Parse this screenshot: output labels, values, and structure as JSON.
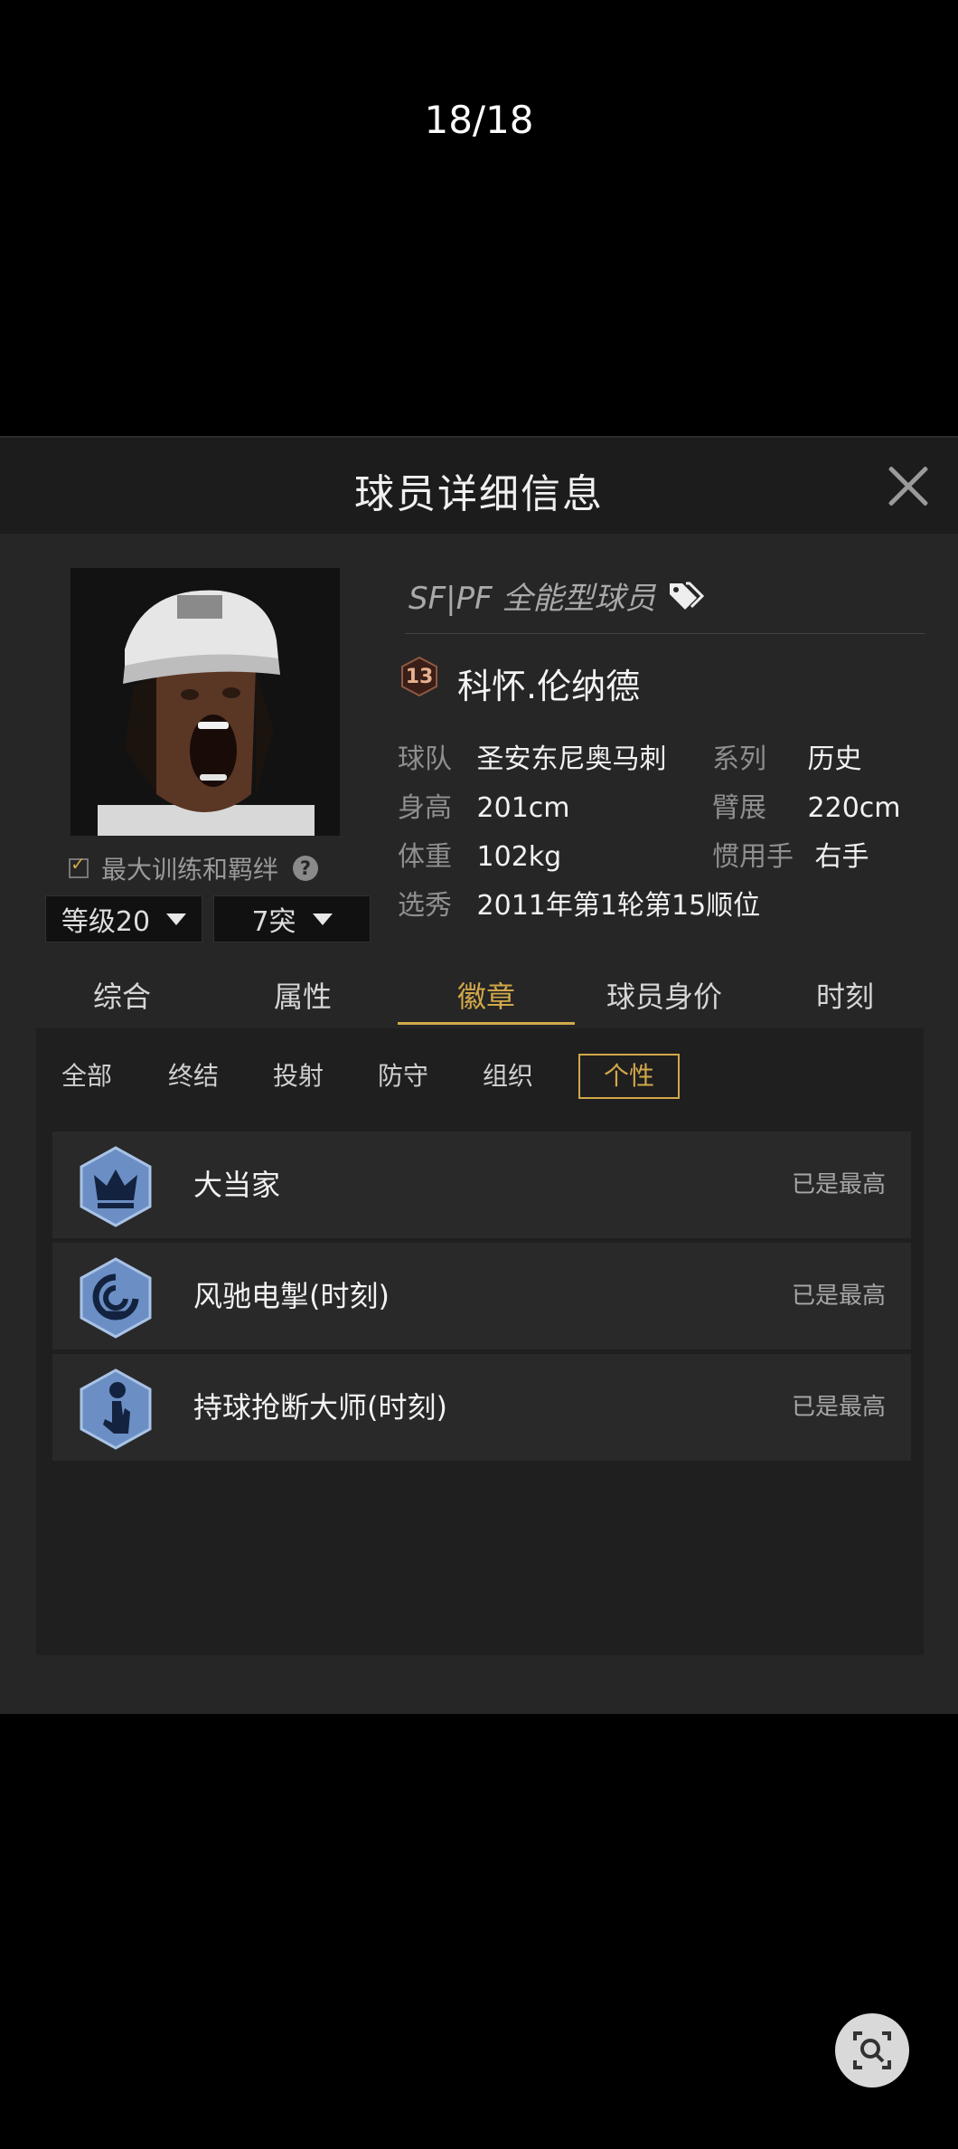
{
  "viewer": {
    "counter": "18/18"
  },
  "header": {
    "title": "球员详细信息"
  },
  "player": {
    "position_text": "SF|PF 全能型球员",
    "rank": "13",
    "name": "科怀.伦纳德",
    "info": [
      {
        "label": "球队",
        "value": "圣安东尼奥马刺"
      },
      {
        "label": "系列",
        "value": "历史"
      },
      {
        "label": "身高",
        "value": "201cm"
      },
      {
        "label": "臂展",
        "value": "220cm"
      },
      {
        "label": "体重",
        "value": "102kg"
      },
      {
        "label": "惯用手",
        "value": "右手"
      },
      {
        "label": "选秀",
        "value": "2011年第1轮第15顺位"
      }
    ]
  },
  "training": {
    "label": "最大训练和羁绊",
    "checked": true
  },
  "level_select": {
    "value": "等级20"
  },
  "break_select": {
    "value": "7突"
  },
  "tabs": [
    "综合",
    "属性",
    "徽章",
    "球员身价",
    "时刻"
  ],
  "active_tab": "徽章",
  "filters": [
    "全部",
    "终结",
    "投射",
    "防守",
    "组织",
    "个性"
  ],
  "active_filter": "个性",
  "badges": [
    {
      "name": "大当家",
      "status": "已是最高",
      "icon": "crown-badge-icon"
    },
    {
      "name": "风驰电掣(时刻)",
      "status": "已是最高",
      "icon": "swirl-badge-icon"
    },
    {
      "name": "持球抢断大师(时刻)",
      "status": "已是最高",
      "icon": "steal-hand-badge-icon"
    }
  ],
  "colors": {
    "accent": "#d2a84a",
    "panel": "#262626",
    "badge_blue": "#6b8fc4"
  }
}
